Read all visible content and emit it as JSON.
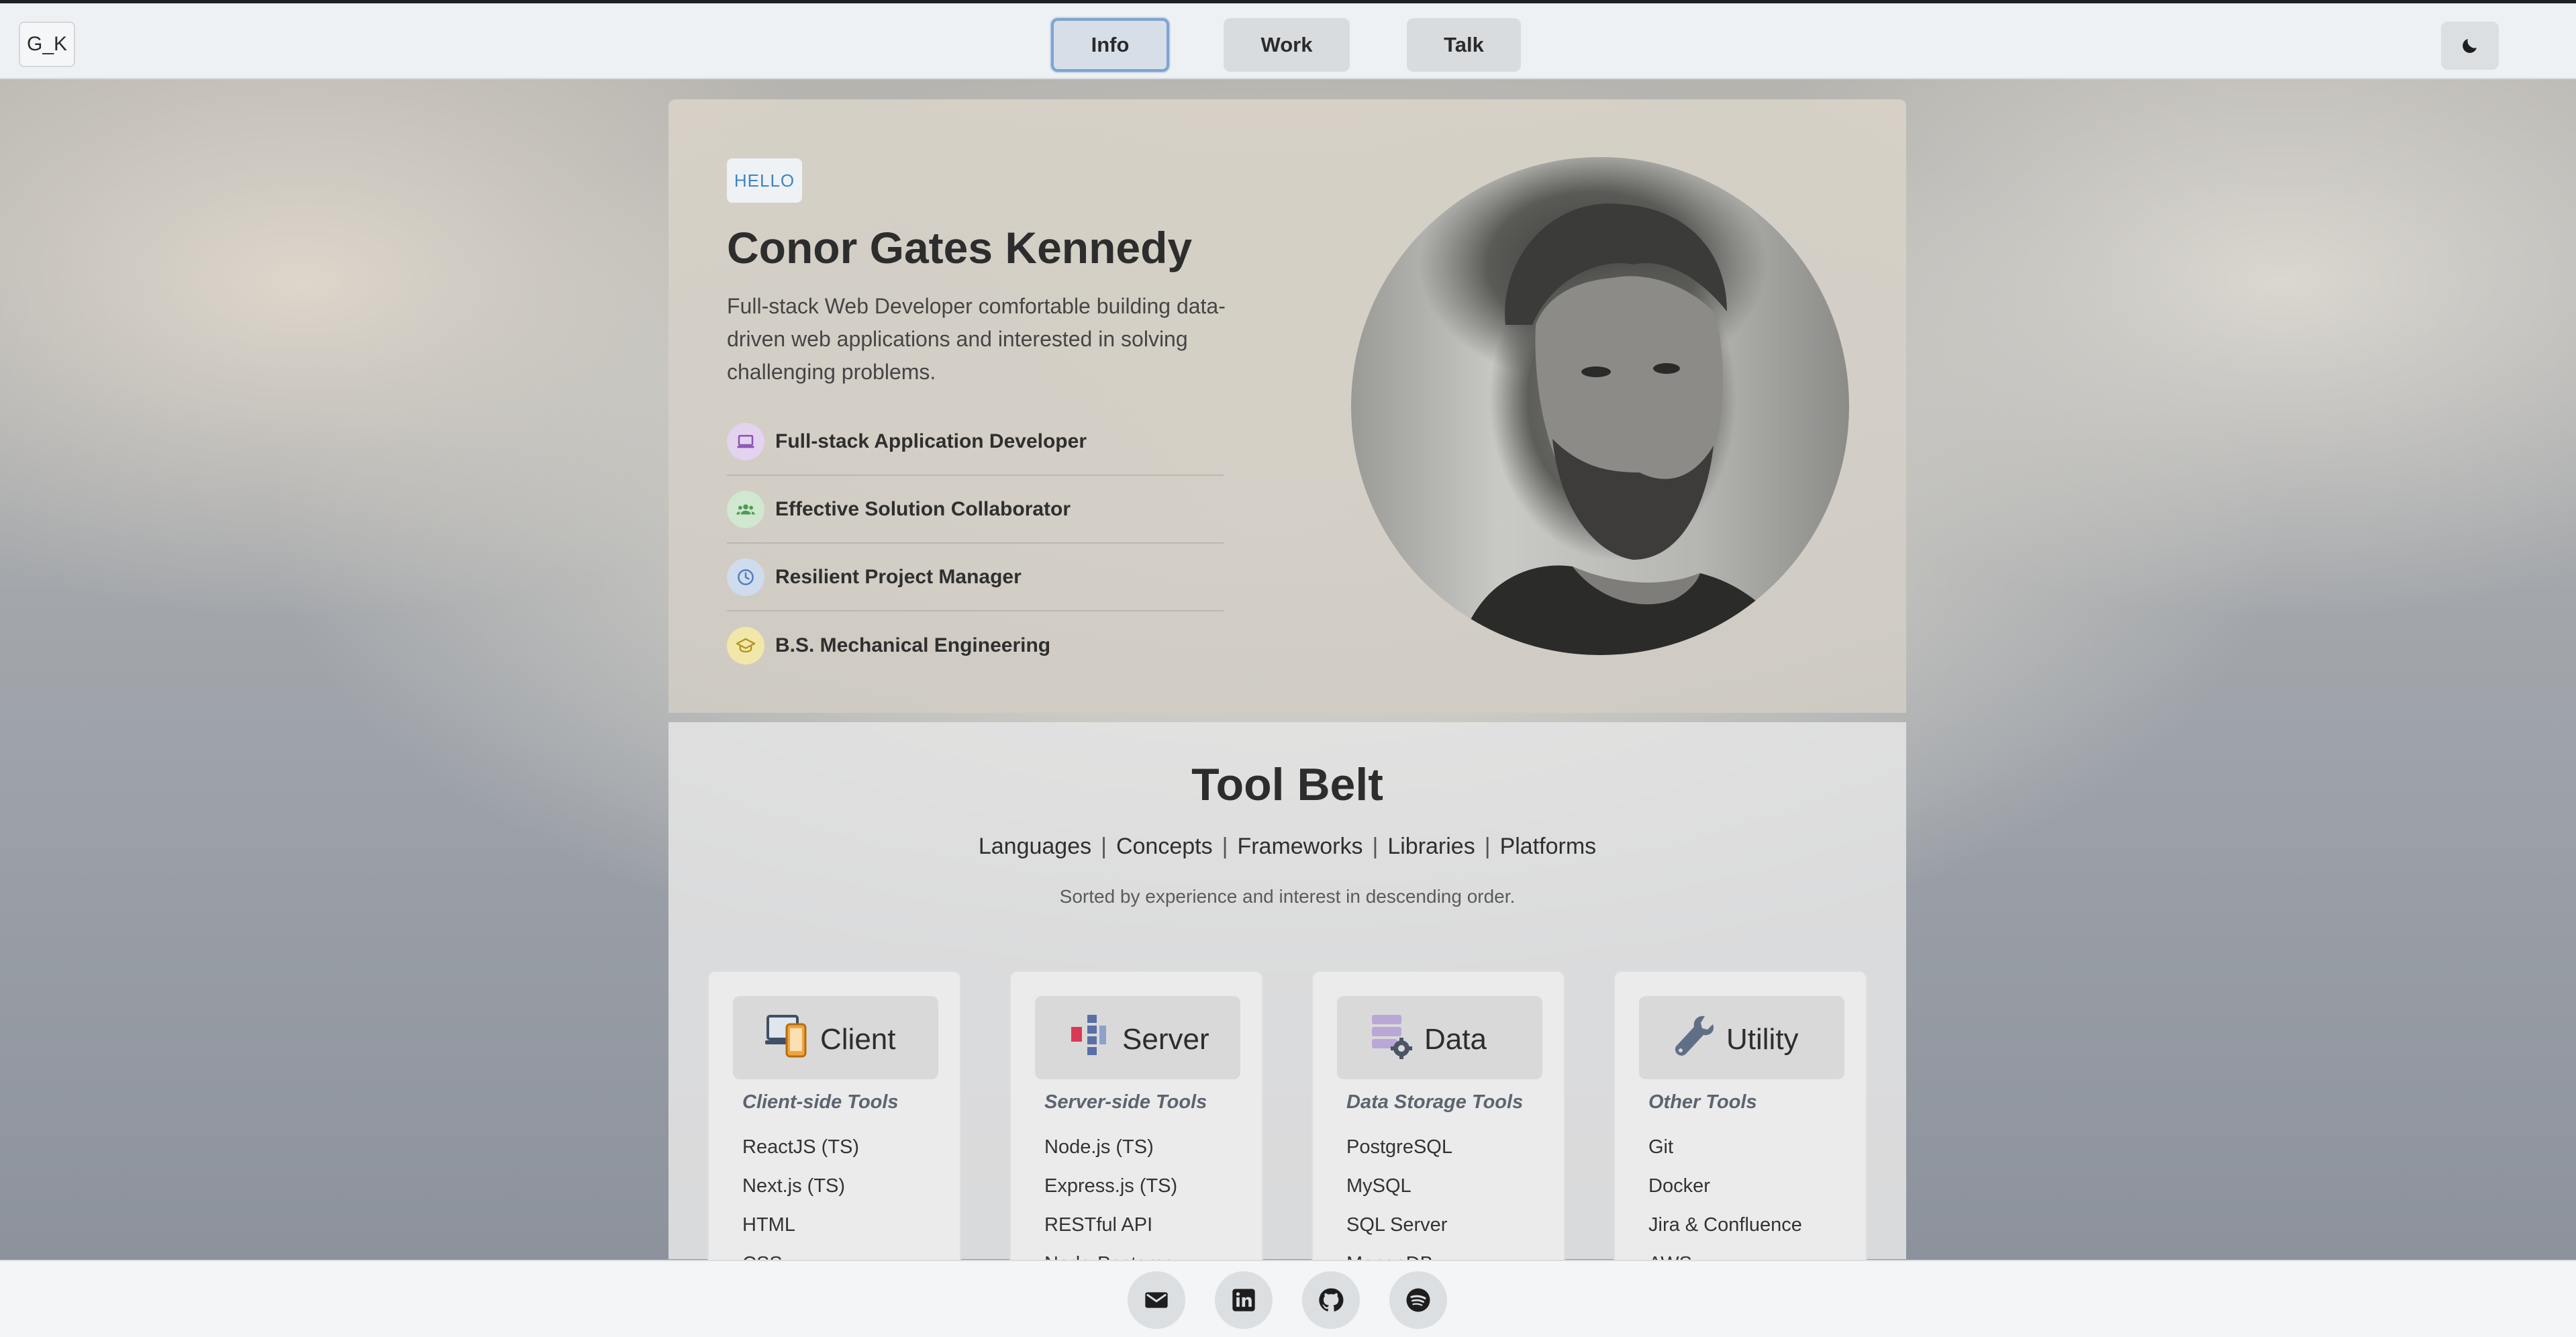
{
  "header": {
    "logo": "G_K",
    "nav": [
      {
        "label": "Info",
        "active": true
      },
      {
        "label": "Work",
        "active": false
      },
      {
        "label": "Talk",
        "active": false
      }
    ],
    "theme_toggle_icon": "moon-icon"
  },
  "hero": {
    "badge": "HELLO",
    "name": "Conor Gates Kennedy",
    "description": "Full-stack Web Developer comfortable building data-driven web applications and interested in solving challenging problems.",
    "traits": [
      {
        "label": "Full-stack Application Developer",
        "icon": "laptop-icon",
        "color": "#e3d3ee"
      },
      {
        "label": "Effective Solution Collaborator",
        "icon": "group-icon",
        "color": "#cfe8cf"
      },
      {
        "label": "Resilient Project Manager",
        "icon": "clock-icon",
        "color": "#cfdcee"
      },
      {
        "label": "B.S. Mechanical Engineering",
        "icon": "graduation-cap-icon",
        "color": "#f1e7a8"
      }
    ],
    "portrait_icon": "portrait-photo"
  },
  "toolbelt": {
    "title": "Tool Belt",
    "categories": [
      "Languages",
      "Concepts",
      "Frameworks",
      "Libraries",
      "Platforms"
    ],
    "separator": "|",
    "subtitle": "Sorted by experience and interest in descending order.",
    "cards": [
      {
        "title": "Client",
        "subtitle": "Client-side Tools",
        "icon": "devices-icon",
        "items": [
          "ReactJS (TS)",
          "Next.js (TS)",
          "HTML",
          "CSS"
        ]
      },
      {
        "title": "Server",
        "subtitle": "Server-side Tools",
        "icon": "server-icon",
        "items": [
          "Node.js (TS)",
          "Express.js (TS)",
          "RESTful API",
          "Node-Postgres"
        ]
      },
      {
        "title": "Data",
        "subtitle": "Data Storage Tools",
        "icon": "database-icon",
        "items": [
          "PostgreSQL",
          "MySQL",
          "SQL Server",
          "MongoDB"
        ]
      },
      {
        "title": "Utility",
        "subtitle": "Other Tools",
        "icon": "wrench-icon",
        "items": [
          "Git",
          "Docker",
          "Jira & Confluence",
          "AWS"
        ]
      }
    ]
  },
  "footer": {
    "links": [
      "email-icon",
      "linkedin-icon",
      "github-icon",
      "spotify-icon"
    ]
  }
}
